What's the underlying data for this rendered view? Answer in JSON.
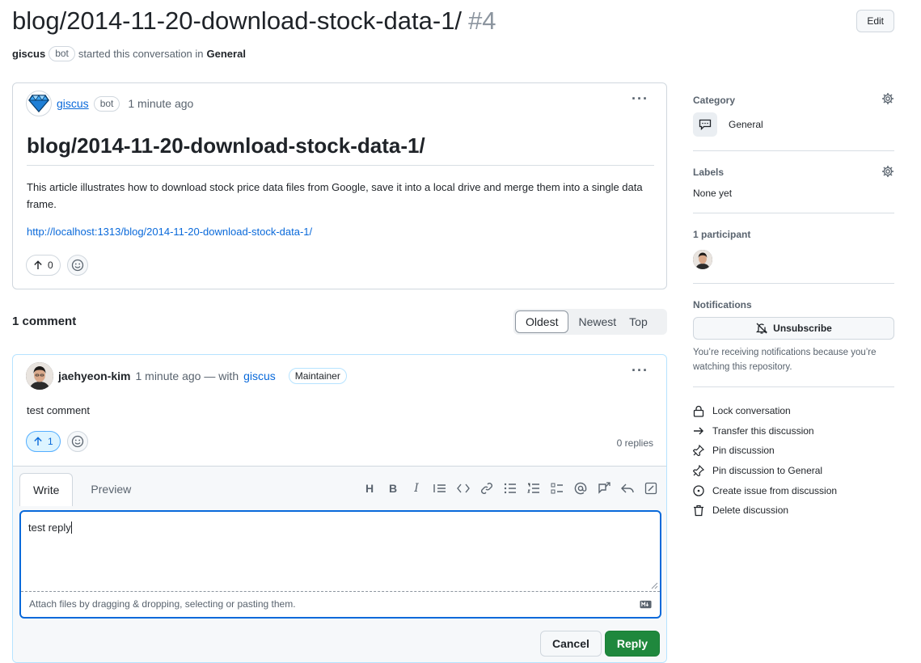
{
  "header": {
    "title": "blog/2014-11-20-download-stock-data-1/",
    "number": "#4",
    "edit_label": "Edit",
    "author": "giscus",
    "author_badge": "bot",
    "started_text": "started this conversation in",
    "category": "General"
  },
  "post": {
    "author": "giscus",
    "badge": "bot",
    "time": "1 minute ago",
    "title": "blog/2014-11-20-download-stock-data-1/",
    "body": "This article illustrates how to download stock price data files from Google, save it into a local drive and merge them into a single data frame.",
    "url": "http://localhost:1313/blog/2014-11-20-download-stock-data-1/",
    "upvotes": "0"
  },
  "comments": {
    "count_label": "1 comment",
    "sort_tabs": [
      "Oldest",
      "Newest",
      "Top"
    ]
  },
  "comment": {
    "author": "jaehyeon-kim",
    "time": "1 minute ago — with",
    "via": "giscus",
    "badge": "Maintainer",
    "body": "test comment",
    "upvotes": "1",
    "replies": "0 replies"
  },
  "reply": {
    "tab_write": "Write",
    "tab_preview": "Preview",
    "text": "test reply",
    "attach_hint": "Attach files by dragging & dropping, selecting or pasting them.",
    "cancel_label": "Cancel",
    "reply_label": "Reply"
  },
  "sidebar": {
    "category_head": "Category",
    "category": "General",
    "labels_head": "Labels",
    "labels_value": "None yet",
    "participants_head": "1 participant",
    "notifications_head": "Notifications",
    "unsubscribe_label": "Unsubscribe",
    "notification_note": "You’re receiving notifications because you’re watching this repository.",
    "actions": [
      {
        "label": "Lock conversation",
        "icon": "lock-icon"
      },
      {
        "label": "Transfer this discussion",
        "icon": "arrow-right-icon"
      },
      {
        "label": "Pin discussion",
        "icon": "pin-icon"
      },
      {
        "label": "Pin discussion to General",
        "icon": "pin-icon"
      },
      {
        "label": "Create issue from discussion",
        "icon": "issue-opened-icon"
      },
      {
        "label": "Delete discussion",
        "icon": "trash-icon"
      }
    ]
  }
}
